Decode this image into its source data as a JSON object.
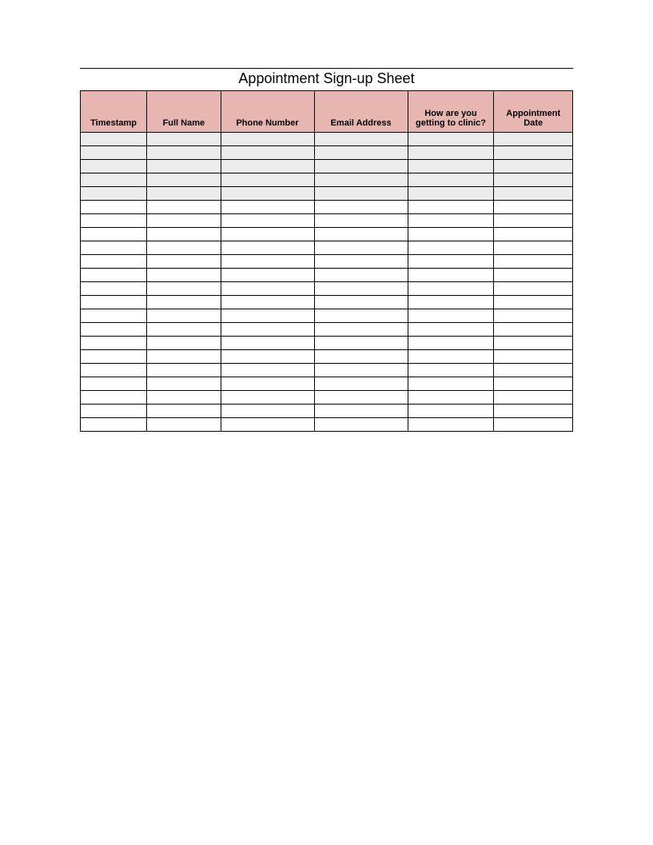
{
  "title": "Appointment Sign-up Sheet",
  "columns": [
    "Timestamp",
    "Full Name",
    "Phone Number",
    "Email Address",
    "How are you getting to clinic?",
    "Appointment Date"
  ],
  "shadedRowCount": 5,
  "plainRowCount": 17
}
